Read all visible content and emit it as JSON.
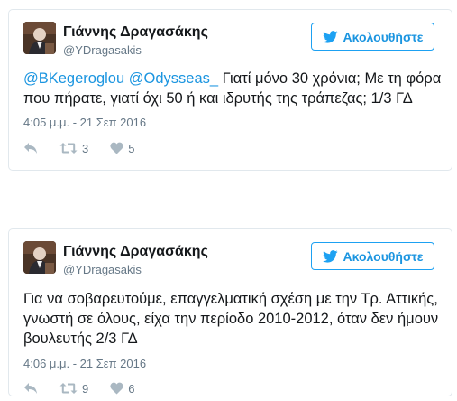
{
  "tweets": [
    {
      "author": {
        "name": "Γιάννης Δραγασάκης",
        "handle": "@YDragasakis"
      },
      "follow_label": "Ακολουθήστε",
      "text": {
        "mention1": "@BKegeroglou",
        "mention2": "@Odysseas_",
        "body": " Γιατί μόνο 30 χρόνια; Με τη φόρα που πήρατε, γιατί όχι 50 ή και ιδρυτής της τράπεζας; 1/3 ΓΔ"
      },
      "timestamp": "4:05 μ.μ. - 21 Σεπ 2016",
      "retweets": "3",
      "likes": "5"
    },
    {
      "author": {
        "name": "Γιάννης Δραγασάκης",
        "handle": "@YDragasakis"
      },
      "follow_label": "Ακολουθήστε",
      "text": {
        "body": "Για να σοβαρευτούμε, επαγγελματική σχέση με την Τρ. Αττικής, γνωστή σε όλους, είχα την περίοδο 2010-2012, όταν δεν ήμουν βουλευτής 2/3 ΓΔ"
      },
      "timestamp": "4:06 μ.μ. - 21 Σεπ 2016",
      "retweets": "9",
      "likes": "6"
    }
  ],
  "icons": {
    "follow": "twitter-bird-icon",
    "reply": "reply-icon",
    "retweet": "retweet-icon",
    "like": "heart-icon"
  },
  "colors": {
    "accent": "#1da1f2",
    "link": "#1b95e0",
    "text": "#14171a",
    "muted": "#657786",
    "border": "#e1e8ed"
  }
}
